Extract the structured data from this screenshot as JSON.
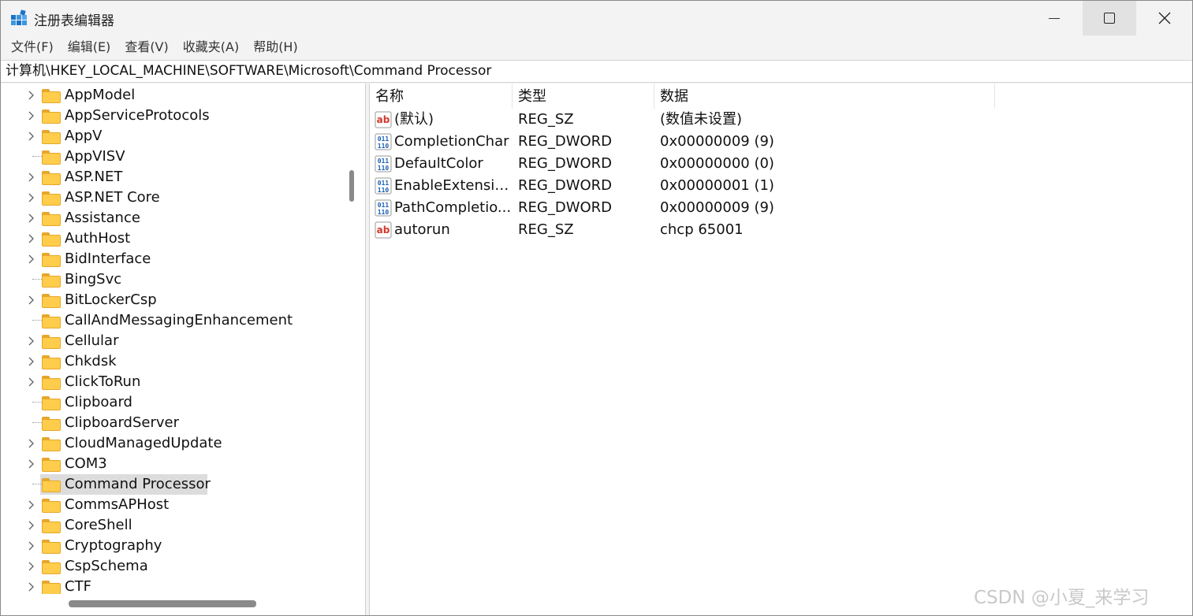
{
  "window": {
    "title": "注册表编辑器",
    "accent": "#0078d4"
  },
  "menu": [
    {
      "label": "文件(F)"
    },
    {
      "label": "编辑(E)"
    },
    {
      "label": "查看(V)"
    },
    {
      "label": "收藏夹(A)"
    },
    {
      "label": "帮助(H)"
    }
  ],
  "address": {
    "path": "计算机\\HKEY_LOCAL_MACHINE\\SOFTWARE\\Microsoft\\Command Processor"
  },
  "tree": {
    "items": [
      {
        "label": "AppModel",
        "expandable": true
      },
      {
        "label": "AppServiceProtocols",
        "expandable": true
      },
      {
        "label": "AppV",
        "expandable": true
      },
      {
        "label": "AppVISV",
        "expandable": false
      },
      {
        "label": "ASP.NET",
        "expandable": true
      },
      {
        "label": "ASP.NET Core",
        "expandable": true
      },
      {
        "label": "Assistance",
        "expandable": true
      },
      {
        "label": "AuthHost",
        "expandable": true
      },
      {
        "label": "BidInterface",
        "expandable": true
      },
      {
        "label": "BingSvc",
        "expandable": false
      },
      {
        "label": "BitLockerCsp",
        "expandable": true
      },
      {
        "label": "CallAndMessagingEnhancement",
        "expandable": false
      },
      {
        "label": "Cellular",
        "expandable": true
      },
      {
        "label": "Chkdsk",
        "expandable": true
      },
      {
        "label": "ClickToRun",
        "expandable": true
      },
      {
        "label": "Clipboard",
        "expandable": false
      },
      {
        "label": "ClipboardServer",
        "expandable": false
      },
      {
        "label": "CloudManagedUpdate",
        "expandable": true
      },
      {
        "label": "COM3",
        "expandable": true
      },
      {
        "label": "Command Processor",
        "expandable": false,
        "selected": true
      },
      {
        "label": "CommsAPHost",
        "expandable": true
      },
      {
        "label": "CoreShell",
        "expandable": true
      },
      {
        "label": "Cryptography",
        "expandable": true
      },
      {
        "label": "CspSchema",
        "expandable": true
      },
      {
        "label": "CTF",
        "expandable": true
      }
    ]
  },
  "values": {
    "columns": {
      "name": "名称",
      "type": "类型",
      "data": "数据"
    },
    "rows": [
      {
        "name": "(默认)",
        "type": "REG_SZ",
        "data": "(数值未设置)",
        "icon": "string-value-icon"
      },
      {
        "name": "CompletionChar",
        "type": "REG_DWORD",
        "data": "0x00000009 (9)",
        "icon": "binary-value-icon"
      },
      {
        "name": "DefaultColor",
        "type": "REG_DWORD",
        "data": "0x00000000 (0)",
        "icon": "binary-value-icon"
      },
      {
        "name": "EnableExtensions",
        "type": "REG_DWORD",
        "data": "0x00000001 (1)",
        "icon": "binary-value-icon"
      },
      {
        "name": "PathCompletio...",
        "type": "REG_DWORD",
        "data": "0x00000009 (9)",
        "icon": "binary-value-icon"
      },
      {
        "name": "autorun",
        "type": "REG_SZ",
        "data": "chcp 65001",
        "icon": "string-value-icon"
      }
    ]
  },
  "watermark": "CSDN @小夏_来学习"
}
